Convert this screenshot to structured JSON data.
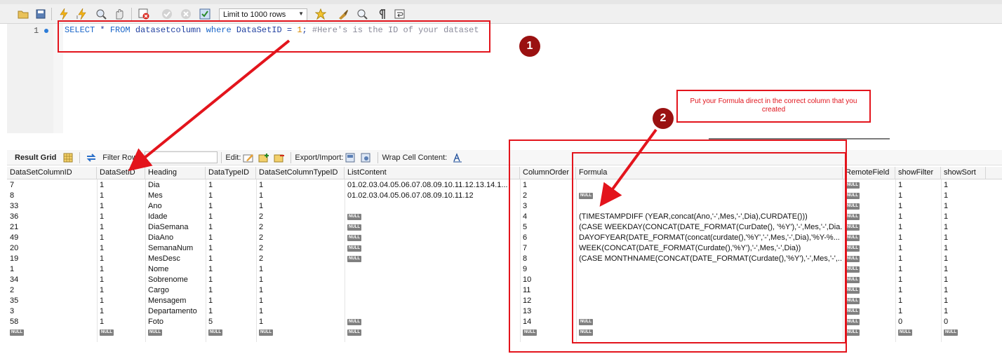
{
  "toolbar": {
    "limit_select_value": "Limit to 1000 rows",
    "icons": [
      "open-folder-icon",
      "save-icon",
      "execute-icon",
      "execute-current-icon",
      "explain-icon",
      "stop-icon",
      "toggle-error-icon",
      "commit-icon",
      "rollback-icon",
      "autocommit-icon",
      "beautify-icon",
      "find-icon",
      "invisible-chars-icon",
      "wrap-icon"
    ]
  },
  "editor": {
    "line_number": "1",
    "code": {
      "kw1": "SELECT",
      "star": " * ",
      "kw2": "FROM",
      "table": " datasetcolumn ",
      "kw3": "where",
      "cond": " DataSetID = ",
      "num": "1",
      "semi": "; ",
      "comment": "#Here's is the ID of your dataset"
    }
  },
  "result_bar": {
    "result_grid_label": "Result Grid",
    "filter_rows_label": "Filter Rows:",
    "edit_label": "Edit:",
    "export_import_label": "Export/Import:",
    "wrap_label": "Wrap Cell Content:"
  },
  "grid": {
    "columns": [
      "DataSetColumnID",
      "DataSetID",
      "Heading",
      "DataTypeID",
      "DataSetColumnTypeID",
      "ListContent",
      "ColumnOrder",
      "Formula",
      "RemoteField",
      "showFilter",
      "showSort"
    ],
    "null_text": "NULL",
    "rows": [
      [
        "7",
        "1",
        "Dia",
        "1",
        "1",
        "01.02.03.04.05.06.07.08.09.10.11.12.13.14.1...",
        "1",
        "",
        "NULL",
        "1",
        "1"
      ],
      [
        "8",
        "1",
        "Mes",
        "1",
        "1",
        "01.02.03.04.05.06.07.08.09.10.11.12",
        "2",
        "NULL",
        "NULL",
        "1",
        "1"
      ],
      [
        "33",
        "1",
        "Ano",
        "1",
        "1",
        "",
        "3",
        "",
        "NULL",
        "1",
        "1"
      ],
      [
        "36",
        "1",
        "Idade",
        "1",
        "2",
        "NULL",
        "4",
        "(TIMESTAMPDIFF (YEAR,concat(Ano,'-',Mes,'-',Dia),CURDATE()))",
        "NULL",
        "1",
        "1"
      ],
      [
        "21",
        "1",
        "DiaSemana",
        "1",
        "2",
        "NULL",
        "5",
        "(CASE WEEKDAY(CONCAT(DATE_FORMAT(CurDate(), '%Y'),'-',Mes,'-',Dia...",
        "NULL",
        "1",
        "1"
      ],
      [
        "49",
        "1",
        "DiaAno",
        "1",
        "2",
        "NULL",
        "6",
        "DAYOFYEAR(DATE_FORMAT(concat(curdate(),'%Y','-',Mes,'-',Dia),'%Y-%...",
        "NULL",
        "1",
        "1"
      ],
      [
        "20",
        "1",
        "SemanaNum",
        "1",
        "2",
        "NULL",
        "7",
        "WEEK(CONCAT(DATE_FORMAT(Curdate(),'%Y'),'-',Mes,'-',Dia))",
        "NULL",
        "1",
        "1"
      ],
      [
        "19",
        "1",
        "MesDesc",
        "1",
        "2",
        "NULL",
        "8",
        "(CASE MONTHNAME(CONCAT(DATE_FORMAT(Curdate(),'%Y'),'-',Mes,'-',...",
        "NULL",
        "1",
        "1"
      ],
      [
        "1",
        "1",
        "Nome",
        "1",
        "1",
        "",
        "9",
        "",
        "NULL",
        "1",
        "1"
      ],
      [
        "34",
        "1",
        "Sobrenome",
        "1",
        "1",
        "",
        "10",
        "",
        "NULL",
        "1",
        "1"
      ],
      [
        "2",
        "1",
        "Cargo",
        "1",
        "1",
        "",
        "11",
        "",
        "NULL",
        "1",
        "1"
      ],
      [
        "35",
        "1",
        "Mensagem",
        "1",
        "1",
        "",
        "12",
        "",
        "NULL",
        "1",
        "1"
      ],
      [
        "3",
        "1",
        "Departamento",
        "1",
        "1",
        "",
        "13",
        "",
        "NULL",
        "1",
        "1"
      ],
      [
        "58",
        "1",
        "Foto",
        "5",
        "1",
        "NULL",
        "14",
        "NULL",
        "NULL",
        "0",
        "0"
      ],
      [
        "NULL",
        "NULL",
        "NULL",
        "NULL",
        "NULL",
        "NULL",
        "NULL",
        "NULL",
        "NULL",
        "NULL",
        "NULL"
      ]
    ]
  },
  "annotations": {
    "badge1": "1",
    "badge2": "2",
    "callout_text": "Put your Formula direct in the correct column that you created",
    "annotation_color": "#e3141c",
    "badge_color": "#9a1111"
  }
}
